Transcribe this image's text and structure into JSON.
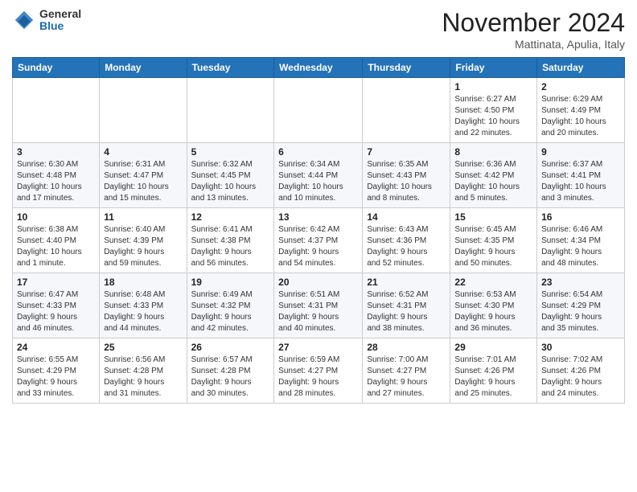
{
  "header": {
    "logo_line1": "General",
    "logo_line2": "Blue",
    "month_title": "November 2024",
    "subtitle": "Mattinata, Apulia, Italy"
  },
  "weekdays": [
    "Sunday",
    "Monday",
    "Tuesday",
    "Wednesday",
    "Thursday",
    "Friday",
    "Saturday"
  ],
  "rows": [
    [
      {
        "day": "",
        "info": ""
      },
      {
        "day": "",
        "info": ""
      },
      {
        "day": "",
        "info": ""
      },
      {
        "day": "",
        "info": ""
      },
      {
        "day": "",
        "info": ""
      },
      {
        "day": "1",
        "info": "Sunrise: 6:27 AM\nSunset: 4:50 PM\nDaylight: 10 hours\nand 22 minutes."
      },
      {
        "day": "2",
        "info": "Sunrise: 6:29 AM\nSunset: 4:49 PM\nDaylight: 10 hours\nand 20 minutes."
      }
    ],
    [
      {
        "day": "3",
        "info": "Sunrise: 6:30 AM\nSunset: 4:48 PM\nDaylight: 10 hours\nand 17 minutes."
      },
      {
        "day": "4",
        "info": "Sunrise: 6:31 AM\nSunset: 4:47 PM\nDaylight: 10 hours\nand 15 minutes."
      },
      {
        "day": "5",
        "info": "Sunrise: 6:32 AM\nSunset: 4:45 PM\nDaylight: 10 hours\nand 13 minutes."
      },
      {
        "day": "6",
        "info": "Sunrise: 6:34 AM\nSunset: 4:44 PM\nDaylight: 10 hours\nand 10 minutes."
      },
      {
        "day": "7",
        "info": "Sunrise: 6:35 AM\nSunset: 4:43 PM\nDaylight: 10 hours\nand 8 minutes."
      },
      {
        "day": "8",
        "info": "Sunrise: 6:36 AM\nSunset: 4:42 PM\nDaylight: 10 hours\nand 5 minutes."
      },
      {
        "day": "9",
        "info": "Sunrise: 6:37 AM\nSunset: 4:41 PM\nDaylight: 10 hours\nand 3 minutes."
      }
    ],
    [
      {
        "day": "10",
        "info": "Sunrise: 6:38 AM\nSunset: 4:40 PM\nDaylight: 10 hours\nand 1 minute."
      },
      {
        "day": "11",
        "info": "Sunrise: 6:40 AM\nSunset: 4:39 PM\nDaylight: 9 hours\nand 59 minutes."
      },
      {
        "day": "12",
        "info": "Sunrise: 6:41 AM\nSunset: 4:38 PM\nDaylight: 9 hours\nand 56 minutes."
      },
      {
        "day": "13",
        "info": "Sunrise: 6:42 AM\nSunset: 4:37 PM\nDaylight: 9 hours\nand 54 minutes."
      },
      {
        "day": "14",
        "info": "Sunrise: 6:43 AM\nSunset: 4:36 PM\nDaylight: 9 hours\nand 52 minutes."
      },
      {
        "day": "15",
        "info": "Sunrise: 6:45 AM\nSunset: 4:35 PM\nDaylight: 9 hours\nand 50 minutes."
      },
      {
        "day": "16",
        "info": "Sunrise: 6:46 AM\nSunset: 4:34 PM\nDaylight: 9 hours\nand 48 minutes."
      }
    ],
    [
      {
        "day": "17",
        "info": "Sunrise: 6:47 AM\nSunset: 4:33 PM\nDaylight: 9 hours\nand 46 minutes."
      },
      {
        "day": "18",
        "info": "Sunrise: 6:48 AM\nSunset: 4:33 PM\nDaylight: 9 hours\nand 44 minutes."
      },
      {
        "day": "19",
        "info": "Sunrise: 6:49 AM\nSunset: 4:32 PM\nDaylight: 9 hours\nand 42 minutes."
      },
      {
        "day": "20",
        "info": "Sunrise: 6:51 AM\nSunset: 4:31 PM\nDaylight: 9 hours\nand 40 minutes."
      },
      {
        "day": "21",
        "info": "Sunrise: 6:52 AM\nSunset: 4:31 PM\nDaylight: 9 hours\nand 38 minutes."
      },
      {
        "day": "22",
        "info": "Sunrise: 6:53 AM\nSunset: 4:30 PM\nDaylight: 9 hours\nand 36 minutes."
      },
      {
        "day": "23",
        "info": "Sunrise: 6:54 AM\nSunset: 4:29 PM\nDaylight: 9 hours\nand 35 minutes."
      }
    ],
    [
      {
        "day": "24",
        "info": "Sunrise: 6:55 AM\nSunset: 4:29 PM\nDaylight: 9 hours\nand 33 minutes."
      },
      {
        "day": "25",
        "info": "Sunrise: 6:56 AM\nSunset: 4:28 PM\nDaylight: 9 hours\nand 31 minutes."
      },
      {
        "day": "26",
        "info": "Sunrise: 6:57 AM\nSunset: 4:28 PM\nDaylight: 9 hours\nand 30 minutes."
      },
      {
        "day": "27",
        "info": "Sunrise: 6:59 AM\nSunset: 4:27 PM\nDaylight: 9 hours\nand 28 minutes."
      },
      {
        "day": "28",
        "info": "Sunrise: 7:00 AM\nSunset: 4:27 PM\nDaylight: 9 hours\nand 27 minutes."
      },
      {
        "day": "29",
        "info": "Sunrise: 7:01 AM\nSunset: 4:26 PM\nDaylight: 9 hours\nand 25 minutes."
      },
      {
        "day": "30",
        "info": "Sunrise: 7:02 AM\nSunset: 4:26 PM\nDaylight: 9 hours\nand 24 minutes."
      }
    ]
  ]
}
